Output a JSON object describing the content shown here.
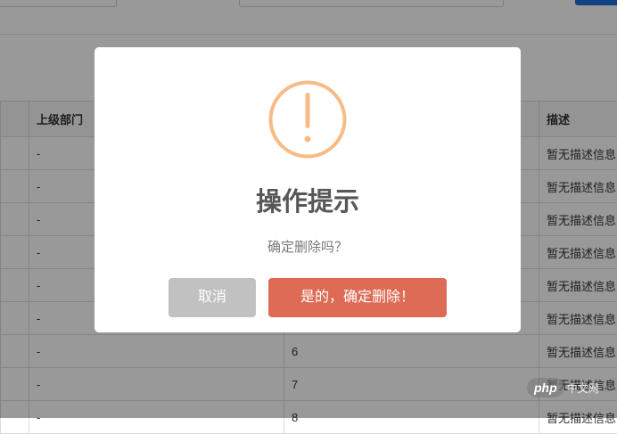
{
  "table": {
    "headers": [
      "",
      "上级部门",
      "",
      "描述"
    ],
    "rows": [
      {
        "parent": "-",
        "order": "",
        "desc": "暂无描述信息"
      },
      {
        "parent": "-",
        "order": "",
        "desc": "暂无描述信息"
      },
      {
        "parent": "-",
        "order": "",
        "desc": "暂无描述信息"
      },
      {
        "parent": "-",
        "order": "",
        "desc": "暂无描述信息"
      },
      {
        "parent": "-",
        "order": "",
        "desc": "暂无描述信息"
      },
      {
        "parent": "-",
        "order": "",
        "desc": "暂无描述信息"
      },
      {
        "parent": "-",
        "order": "6",
        "desc": "暂无描述信息"
      },
      {
        "parent": "-",
        "order": "7",
        "desc": "暂无描述信息"
      },
      {
        "parent": "-",
        "order": "8",
        "desc": "暂无描述信息"
      }
    ]
  },
  "dialog": {
    "icon": "warning-icon",
    "title": "操作提示",
    "text": "确定删除吗？",
    "cancel_label": "取消",
    "confirm_label": "是的，确定删除！"
  },
  "colors": {
    "warning": "#f8bb86",
    "confirm": "#dd6b55",
    "cancel": "#c1c1c1"
  },
  "watermark": {
    "badge": "php",
    "text": "中文网"
  }
}
